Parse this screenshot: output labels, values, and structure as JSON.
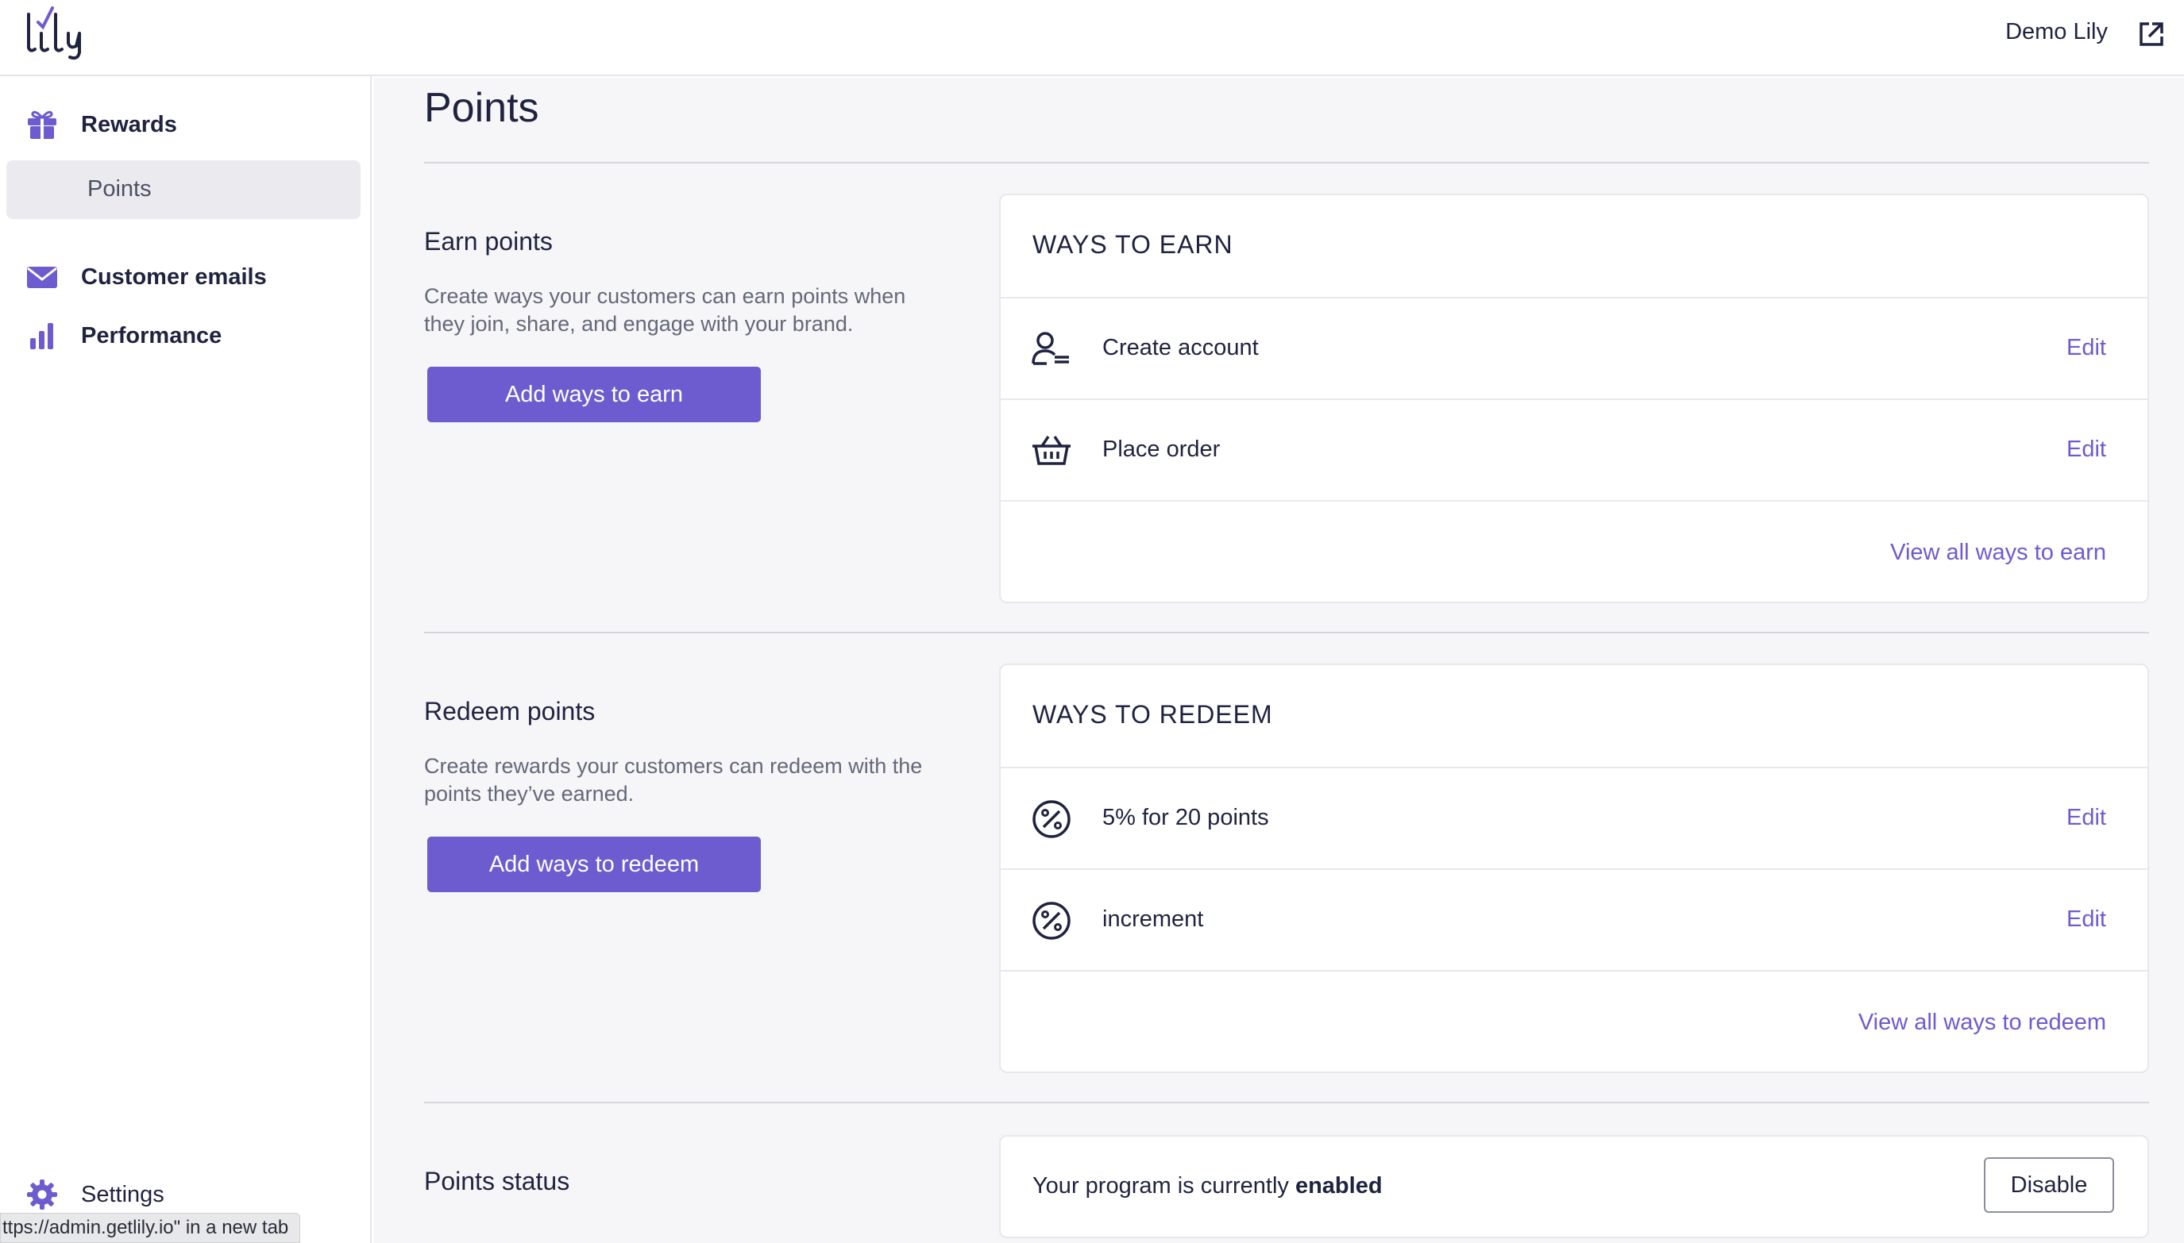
{
  "header": {
    "logo_text": "lily",
    "store_name": "Demo Lily"
  },
  "sidebar": {
    "items": [
      {
        "label": "Rewards",
        "icon": "gift-icon"
      },
      {
        "label": "Points"
      },
      {
        "label": "Customer emails",
        "icon": "envelope-icon"
      },
      {
        "label": "Performance",
        "icon": "bar-chart-icon"
      },
      {
        "label": "Settings",
        "icon": "gear-icon"
      }
    ]
  },
  "status_bar": {
    "link_hint": "ttps://admin.getlily.io\" in a new tab"
  },
  "main": {
    "title": "Points",
    "earn": {
      "title": "Earn points",
      "description": "Create ways your customers can earn points when they join, share, and engage with your brand.",
      "button": "Add ways to earn",
      "card_title": "WAYS TO EARN",
      "rows": [
        {
          "label": "Create account",
          "action": "Edit",
          "icon": "user-list-icon"
        },
        {
          "label": "Place order",
          "action": "Edit",
          "icon": "basket-icon"
        }
      ],
      "view_all": "View all ways to earn"
    },
    "redeem": {
      "title": "Redeem points",
      "description": "Create rewards your customers can redeem with the points they’ve earned.",
      "button": "Add ways to redeem",
      "card_title": "WAYS TO REDEEM",
      "rows": [
        {
          "label": "5% for 20 points",
          "action": "Edit",
          "icon": "percent-circle-icon"
        },
        {
          "label": "increment",
          "action": "Edit",
          "icon": "percent-circle-icon"
        }
      ],
      "view_all": "View all ways to redeem"
    },
    "status": {
      "title": "Points status",
      "text_prefix": "Your program is currently ",
      "text_state": "enabled",
      "button": "Disable"
    }
  },
  "colors": {
    "accent": "#6d5bd0",
    "text": "#1f2340",
    "background": "#f6f6f8"
  }
}
